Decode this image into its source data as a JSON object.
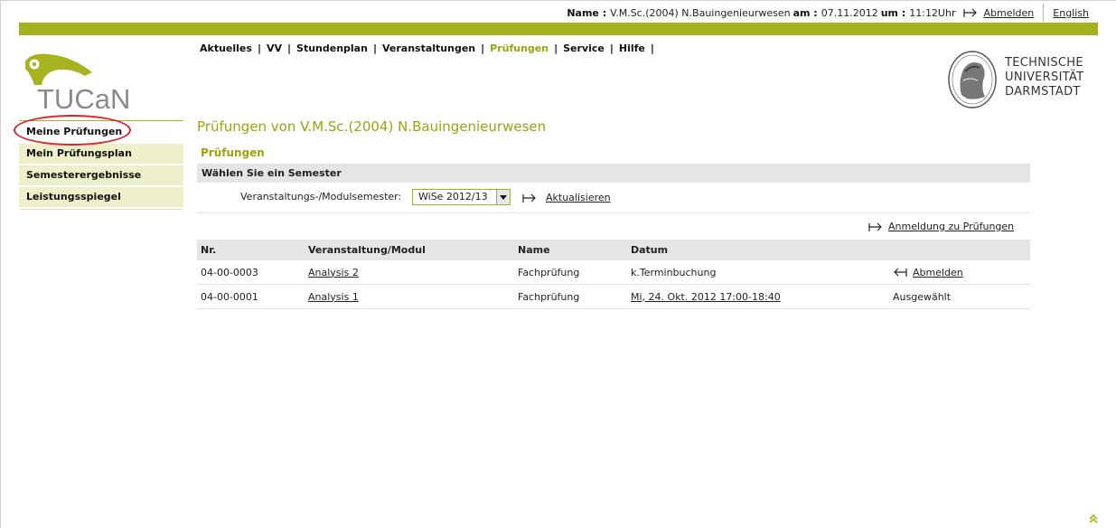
{
  "topbar": {
    "name_label": "Name :",
    "name_value": "V.M.Sc.(2004) N.Bauingenieurwesen",
    "date_label": "am :",
    "date_value": "07.11.2012",
    "time_label": "um :",
    "time_value": "11:12Uhr",
    "logout": "Abmelden",
    "language": "English"
  },
  "nav": {
    "items": [
      {
        "label": "Aktuelles"
      },
      {
        "label": "VV"
      },
      {
        "label": "Stundenplan"
      },
      {
        "label": "Veranstaltungen"
      },
      {
        "label": "Prüfungen",
        "active": true
      },
      {
        "label": "Service"
      },
      {
        "label": "Hilfe"
      }
    ]
  },
  "logo": {
    "tucan": "TUCaN",
    "tud_line1": "TECHNISCHE",
    "tud_line2": "UNIVERSITÄT",
    "tud_line3": "DARMSTADT"
  },
  "sidebar": {
    "items": [
      {
        "label": "Meine Prüfungen"
      },
      {
        "label": "Mein Prüfungsplan"
      },
      {
        "label": "Semesterergebnisse"
      },
      {
        "label": "Leistungsspiegel"
      }
    ]
  },
  "main": {
    "title": "Prüfungen von V.M.Sc.(2004) N.Bauingenieurwesen",
    "section": "Prüfungen",
    "choose_semester": "Wählen Sie ein Semester",
    "semester_label": "Veranstaltungs-/Modulsemester:",
    "semester_value": "WiSe 2012/13",
    "refresh": "Aktualisieren",
    "registration_link": "Anmeldung zu Prüfungen",
    "table": {
      "headers": [
        "Nr.",
        "Veranstaltung/Modul",
        "Name",
        "Datum"
      ],
      "rows": [
        {
          "nr": "04-00-0003",
          "module": "Analysis 2",
          "name": "Fachprüfung",
          "date": "k.Terminbuchung",
          "action": "Abmelden"
        },
        {
          "nr": "04-00-0001",
          "module": "Analysis 1",
          "name": "Fachprüfung",
          "date": "Mi, 24. Okt. 2012 17:00-18:40",
          "action": "Ausgewählt"
        }
      ]
    }
  },
  "colors": {
    "accent": "#a6b21e",
    "accent_text": "#98a40d",
    "highlight_circle": "#d8242e",
    "sidebar_bg": "#eef0c9"
  }
}
